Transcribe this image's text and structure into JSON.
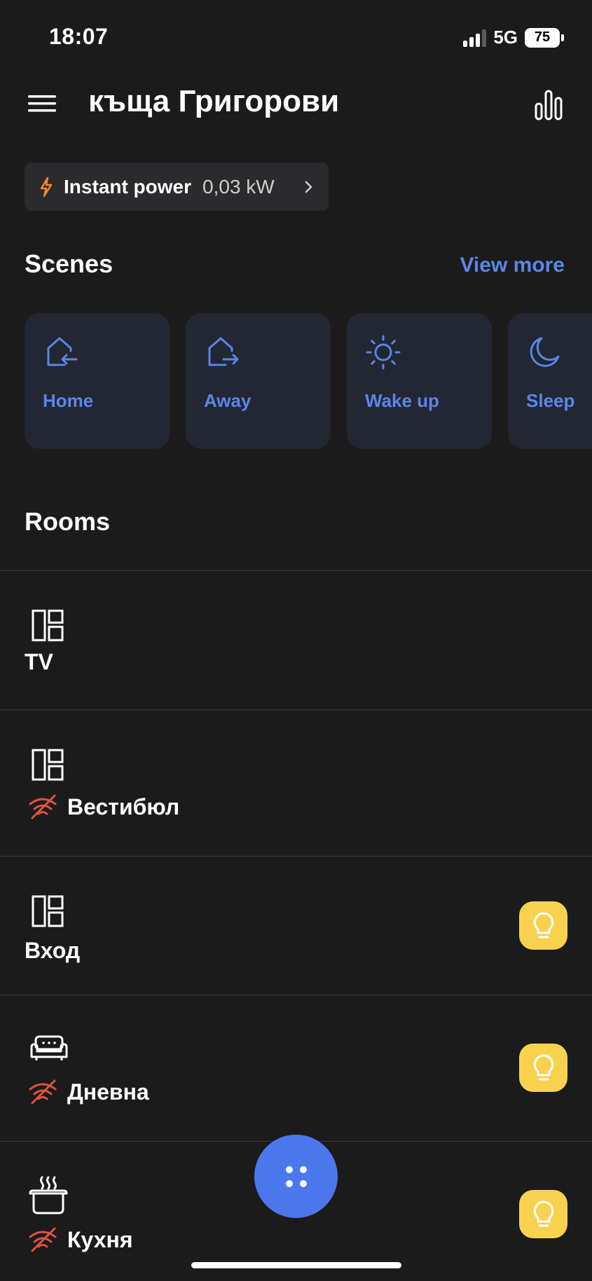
{
  "status_bar": {
    "time": "18:07",
    "network": "5G",
    "battery": "75"
  },
  "header": {
    "title": "къща Григорови"
  },
  "power": {
    "label": "Instant power",
    "value": "0,03 kW"
  },
  "scenes": {
    "title": "Scenes",
    "view_more": "View more",
    "items": [
      {
        "label": "Home",
        "icon": "home-enter-icon"
      },
      {
        "label": "Away",
        "icon": "home-leave-icon"
      },
      {
        "label": "Wake up",
        "icon": "sun-icon"
      },
      {
        "label": "Sleep",
        "icon": "moon-icon"
      }
    ]
  },
  "rooms": {
    "title": "Rooms",
    "items": [
      {
        "name": "TV",
        "icon": "room-layout-icon",
        "offline": false,
        "light": false
      },
      {
        "name": "Вестибюл",
        "icon": "room-layout-icon",
        "offline": true,
        "light": false
      },
      {
        "name": "Вход",
        "icon": "room-layout-icon",
        "offline": false,
        "light": true
      },
      {
        "name": "Дневна",
        "icon": "sofa-icon",
        "offline": true,
        "light": true
      },
      {
        "name": "Кухня",
        "icon": "cooking-pot-icon",
        "offline": true,
        "light": true
      }
    ]
  },
  "colors": {
    "accent": "#5a86e8",
    "fab": "#4a78ec",
    "bulb": "#f8d24e",
    "offline": "#e0533f",
    "bolt": "#f08a2c"
  }
}
